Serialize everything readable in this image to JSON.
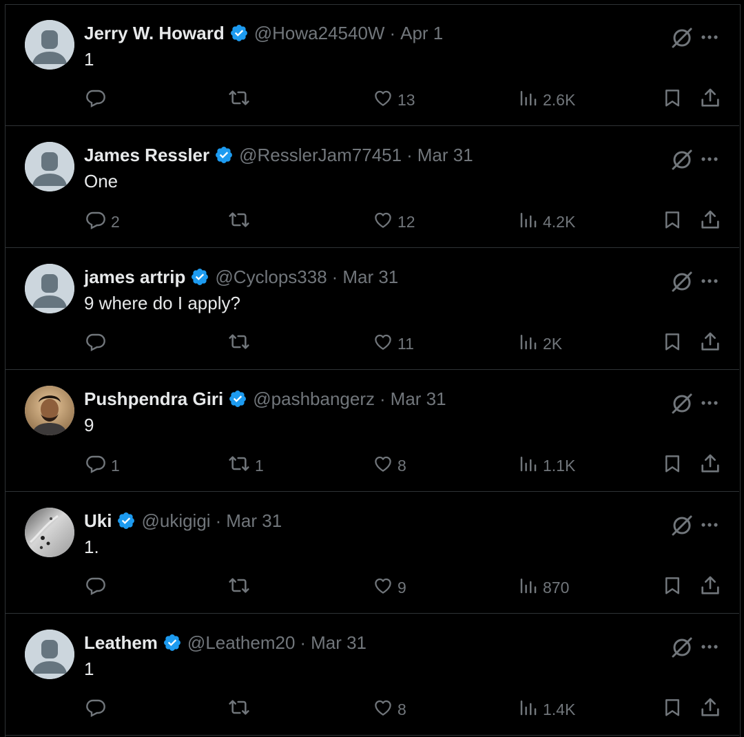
{
  "colors": {
    "background": "#000000",
    "text": "#e7e9ea",
    "muted": "#71767b",
    "verified": "#1d9bf0",
    "divider": "#2f3336"
  },
  "tweets": [
    {
      "name": "Jerry W. Howard",
      "handle": "@Howa24540W",
      "sep": "·",
      "date": "Apr 1",
      "text": "1",
      "replies": "",
      "retweets": "",
      "likes": "13",
      "views": "2.6K",
      "avatar": "default"
    },
    {
      "name": "James Ressler",
      "handle": "@ResslerJam77451",
      "sep": "·",
      "date": "Mar 31",
      "text": "One",
      "replies": "2",
      "retweets": "",
      "likes": "12",
      "views": "4.2K",
      "avatar": "default"
    },
    {
      "name": "james artrip",
      "handle": "@Cyclops338",
      "sep": "·",
      "date": "Mar 31",
      "text": "9 where do I apply?",
      "replies": "",
      "retweets": "",
      "likes": "11",
      "views": "2K",
      "avatar": "default"
    },
    {
      "name": "Pushpendra Giri",
      "handle": "@pashbangerz",
      "sep": "·",
      "date": "Mar 31",
      "text": "9",
      "replies": "1",
      "retweets": "1",
      "likes": "8",
      "views": "1.1K",
      "avatar": "photo"
    },
    {
      "name": "Uki",
      "handle": "@ukigigi",
      "sep": "·",
      "date": "Mar 31",
      "text": "1.",
      "replies": "",
      "retweets": "",
      "likes": "9",
      "views": "870",
      "avatar": "photo"
    },
    {
      "name": "Leathem",
      "handle": "@Leathem20",
      "sep": "·",
      "date": "Mar 31",
      "text": "1",
      "replies": "",
      "retweets": "",
      "likes": "8",
      "views": "1.4K",
      "avatar": "default"
    }
  ],
  "icons": {
    "verified": "verified-badge-icon",
    "grok": "grok-icon",
    "more": "more-dots-icon",
    "reply": "reply-icon",
    "retweet": "retweet-icon",
    "like": "heart-icon",
    "views": "views-chart-icon",
    "bookmark": "bookmark-icon",
    "share": "share-icon"
  }
}
